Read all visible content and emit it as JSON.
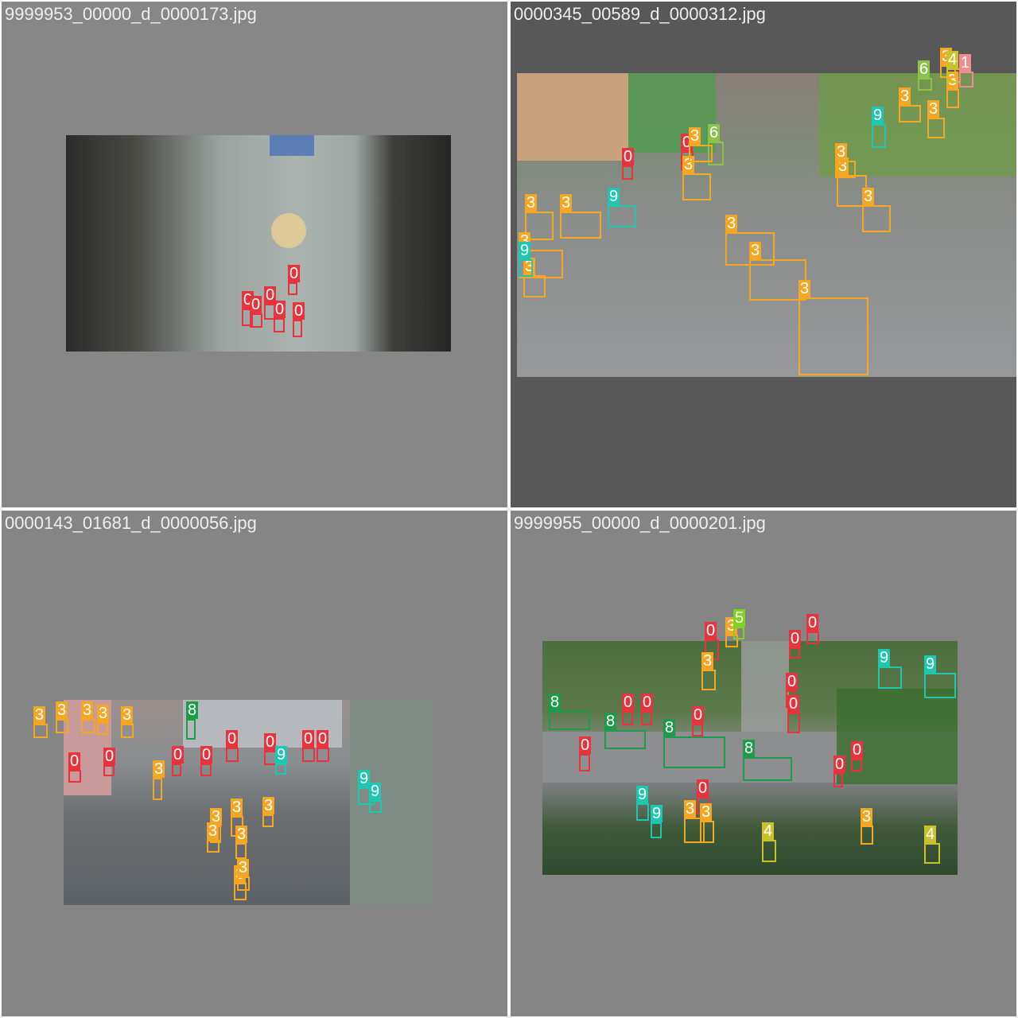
{
  "colors": {
    "0": "#e8333c",
    "1": "#f28b8b",
    "3": "#f5a623",
    "4": "#c9c22a",
    "5": "#7ed321",
    "6": "#8bc34a",
    "8": "#1e9b4a",
    "9": "#1ec7b1"
  },
  "tiles": [
    {
      "filename": "9999953_00000_d_0000173.jpg",
      "detections": [
        {
          "cls": "0"
        },
        {
          "cls": "0"
        },
        {
          "cls": "0"
        },
        {
          "cls": "0"
        },
        {
          "cls": "0"
        },
        {
          "cls": "0"
        }
      ]
    },
    {
      "filename": "0000345_00589_d_0000312.jpg",
      "detections": [
        {
          "cls": "3"
        },
        {
          "cls": "3"
        },
        {
          "cls": "3"
        },
        {
          "cls": "3"
        },
        {
          "cls": "3"
        },
        {
          "cls": "3"
        },
        {
          "cls": "3"
        },
        {
          "cls": "9"
        },
        {
          "cls": "9"
        },
        {
          "cls": "0"
        },
        {
          "cls": "0"
        },
        {
          "cls": "6"
        },
        {
          "cls": "3"
        },
        {
          "cls": "3"
        },
        {
          "cls": "3"
        },
        {
          "cls": "3"
        },
        {
          "cls": "3"
        },
        {
          "cls": "9"
        },
        {
          "cls": "3"
        },
        {
          "cls": "3"
        },
        {
          "cls": "3"
        },
        {
          "cls": "3"
        },
        {
          "cls": "4"
        },
        {
          "cls": "1"
        },
        {
          "cls": "6"
        }
      ]
    },
    {
      "filename": "0000143_01681_d_0000056.jpg",
      "detections": [
        {
          "cls": "3"
        },
        {
          "cls": "3"
        },
        {
          "cls": "3"
        },
        {
          "cls": "3"
        },
        {
          "cls": "3"
        },
        {
          "cls": "3"
        },
        {
          "cls": "3"
        },
        {
          "cls": "3"
        },
        {
          "cls": "3"
        },
        {
          "cls": "3"
        },
        {
          "cls": "0"
        },
        {
          "cls": "0"
        },
        {
          "cls": "0"
        },
        {
          "cls": "0"
        },
        {
          "cls": "0"
        },
        {
          "cls": "0"
        },
        {
          "cls": "0"
        },
        {
          "cls": "0"
        },
        {
          "cls": "9"
        },
        {
          "cls": "9"
        },
        {
          "cls": "9"
        },
        {
          "cls": "8"
        },
        {
          "cls": "3"
        },
        {
          "cls": "3"
        },
        {
          "cls": "3"
        }
      ]
    },
    {
      "filename": "9999955_00000_d_0000201.jpg",
      "detections": [
        {
          "cls": "8"
        },
        {
          "cls": "8"
        },
        {
          "cls": "8"
        },
        {
          "cls": "8"
        },
        {
          "cls": "0"
        },
        {
          "cls": "0"
        },
        {
          "cls": "0"
        },
        {
          "cls": "0"
        },
        {
          "cls": "0"
        },
        {
          "cls": "0"
        },
        {
          "cls": "0"
        },
        {
          "cls": "0"
        },
        {
          "cls": "0"
        },
        {
          "cls": "0"
        },
        {
          "cls": "0"
        },
        {
          "cls": "0"
        },
        {
          "cls": "3"
        },
        {
          "cls": "3"
        },
        {
          "cls": "3"
        },
        {
          "cls": "3"
        },
        {
          "cls": "3"
        },
        {
          "cls": "5"
        },
        {
          "cls": "4"
        },
        {
          "cls": "4"
        },
        {
          "cls": "9"
        },
        {
          "cls": "9"
        },
        {
          "cls": "9"
        },
        {
          "cls": "9"
        }
      ]
    }
  ]
}
